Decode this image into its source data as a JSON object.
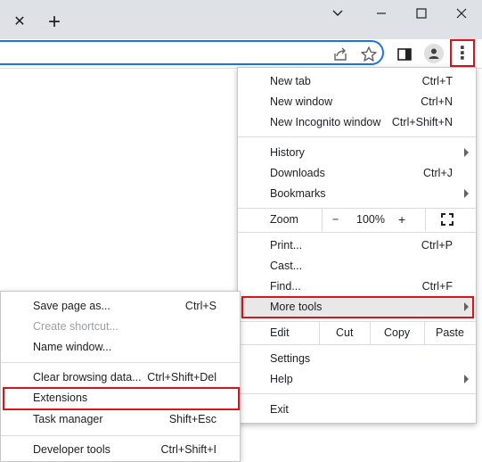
{
  "window_controls": {
    "tab_close": "✕",
    "new_tab": "+"
  },
  "toolbar": {
    "kebab_glyph": "⋮"
  },
  "main_menu": {
    "new_tab": {
      "label": "New tab",
      "shortcut": "Ctrl+T"
    },
    "new_window": {
      "label": "New window",
      "shortcut": "Ctrl+N"
    },
    "new_incognito": {
      "label": "New Incognito window",
      "shortcut": "Ctrl+Shift+N"
    },
    "history": {
      "label": "History"
    },
    "downloads": {
      "label": "Downloads",
      "shortcut": "Ctrl+J"
    },
    "bookmarks": {
      "label": "Bookmarks"
    },
    "zoom": {
      "label": "Zoom",
      "minus": "−",
      "value": "100%",
      "plus": "+"
    },
    "print": {
      "label": "Print...",
      "shortcut": "Ctrl+P"
    },
    "cast": {
      "label": "Cast..."
    },
    "find": {
      "label": "Find...",
      "shortcut": "Ctrl+F"
    },
    "more_tools": {
      "label": "More tools"
    },
    "edit": {
      "label": "Edit",
      "cut": "Cut",
      "copy": "Copy",
      "paste": "Paste"
    },
    "settings": {
      "label": "Settings"
    },
    "help": {
      "label": "Help"
    },
    "exit": {
      "label": "Exit"
    }
  },
  "sub_menu": {
    "save_page": {
      "label": "Save page as...",
      "shortcut": "Ctrl+S"
    },
    "create_shortcut": {
      "label": "Create shortcut..."
    },
    "name_window": {
      "label": "Name window..."
    },
    "clear_data": {
      "label": "Clear browsing data...",
      "shortcut": "Ctrl+Shift+Del"
    },
    "extensions": {
      "label": "Extensions"
    },
    "task_manager": {
      "label": "Task manager",
      "shortcut": "Shift+Esc"
    },
    "developer_tools": {
      "label": "Developer tools",
      "shortcut": "Ctrl+Shift+I"
    }
  },
  "colors": {
    "highlight_outline": "#d9141b",
    "omnibox_focus": "#1a73e8",
    "titlebar": "#dee1e6"
  }
}
